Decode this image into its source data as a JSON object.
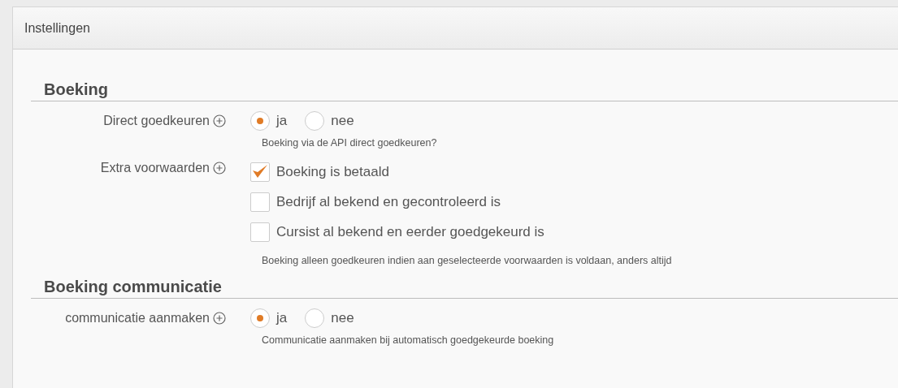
{
  "panel": {
    "title": "Instellingen"
  },
  "sections": [
    {
      "heading": "Boeking",
      "fields": [
        {
          "label": "Direct goedkeuren",
          "kind": "radio",
          "options": [
            {
              "label": "ja",
              "selected": true
            },
            {
              "label": "nee",
              "selected": false
            }
          ],
          "help": "Boeking via de API direct goedkeuren?"
        },
        {
          "label": "Extra voorwaarden",
          "kind": "checkbox",
          "options": [
            {
              "label": "Boeking is betaald",
              "checked": true
            },
            {
              "label": "Bedrijf al bekend en gecontroleerd is",
              "checked": false
            },
            {
              "label": "Cursist al bekend en eerder goedgekeurd is",
              "checked": false
            }
          ],
          "help": "Boeking alleen goedkeuren indien aan geselecteerde voorwaarden is voldaan, anders altijd"
        }
      ]
    },
    {
      "heading": "Boeking communicatie",
      "fields": [
        {
          "label": "communicatie aanmaken",
          "kind": "radio",
          "options": [
            {
              "label": "ja",
              "selected": true
            },
            {
              "label": "nee",
              "selected": false
            }
          ],
          "help": "Communicatie aanmaken bij automatisch goedgekeurde boeking"
        }
      ]
    }
  ]
}
